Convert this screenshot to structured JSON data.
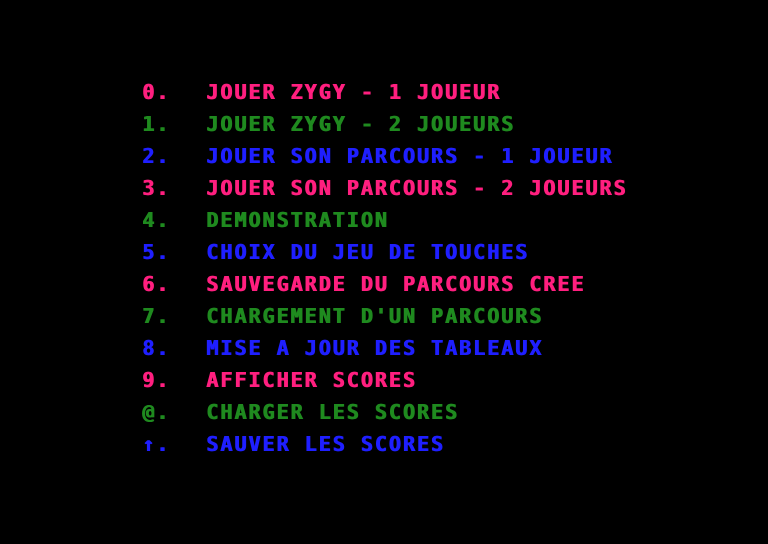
{
  "colors": {
    "background": "#000000",
    "magenta": "#ff1f7f",
    "green": "#1f8a1f",
    "blue": "#1f1fff"
  },
  "menu": {
    "items": [
      {
        "key": "0.",
        "label": "JOUER ZYGY - 1 JOUEUR",
        "color": "magenta"
      },
      {
        "key": "1.",
        "label": "JOUER ZYGY - 2 JOUEURS",
        "color": "green"
      },
      {
        "key": "2.",
        "label": "JOUER SON PARCOURS - 1 JOUEUR",
        "color": "blue"
      },
      {
        "key": "3.",
        "label": "JOUER SON PARCOURS - 2 JOUEURS",
        "color": "magenta"
      },
      {
        "key": "4.",
        "label": "DEMONSTRATION",
        "color": "green"
      },
      {
        "key": "5.",
        "label": "CHOIX DU JEU DE TOUCHES",
        "color": "blue"
      },
      {
        "key": "6.",
        "label": "SAUVEGARDE DU PARCOURS CREE",
        "color": "magenta"
      },
      {
        "key": "7.",
        "label": "CHARGEMENT D'UN PARCOURS",
        "color": "green"
      },
      {
        "key": "8.",
        "label": "MISE A JOUR DES TABLEAUX",
        "color": "blue"
      },
      {
        "key": "9.",
        "label": "AFFICHER SCORES",
        "color": "magenta"
      },
      {
        "key": "@.",
        "label": "CHARGER LES SCORES",
        "color": "green"
      },
      {
        "key": "↑.",
        "label": "SAUVER LES SCORES",
        "color": "blue"
      }
    ]
  }
}
